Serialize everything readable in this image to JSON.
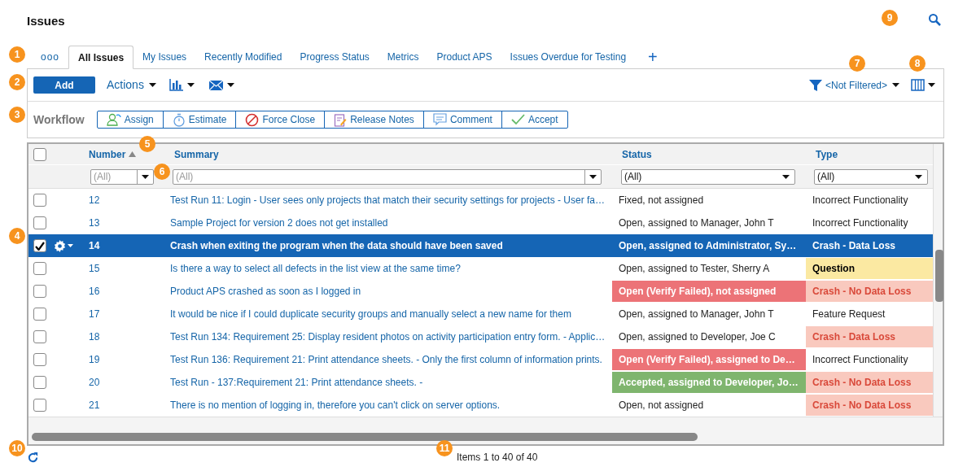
{
  "title": "Issues",
  "tabs": [
    {
      "label": "ooo",
      "selected": false
    },
    {
      "label": "All Issues",
      "selected": true
    },
    {
      "label": "My Issues",
      "selected": false
    },
    {
      "label": "Recently Modified",
      "selected": false
    },
    {
      "label": "Progress Status",
      "selected": false
    },
    {
      "label": "Metrics",
      "selected": false
    },
    {
      "label": "Product APS",
      "selected": false
    },
    {
      "label": "Issues Overdue for Testing",
      "selected": false
    }
  ],
  "add_tab": "+",
  "toolbar": {
    "add": "Add",
    "actions": "Actions",
    "filter": "<Not Filtered>"
  },
  "workflow": {
    "label": "Workflow",
    "buttons": [
      {
        "label": "Assign",
        "kind": "assign"
      },
      {
        "label": "Estimate",
        "kind": "estimate"
      },
      {
        "label": "Force Close",
        "kind": "close"
      },
      {
        "label": "Release Notes",
        "kind": "notes"
      },
      {
        "label": "Comment",
        "kind": "comment"
      },
      {
        "label": "Accept",
        "kind": "accept"
      }
    ]
  },
  "table": {
    "columns": [
      {
        "label": "Number",
        "sorted": true
      },
      {
        "label": "Summary",
        "sorted": false
      },
      {
        "label": "Status",
        "sorted": false
      },
      {
        "label": "Type",
        "sorted": false
      }
    ],
    "select_all": {
      "checked": false
    },
    "filters": [
      "(All)",
      "(All)",
      "(All)",
      "(All)"
    ],
    "rows": [
      {
        "number": "12",
        "summary": "Test Run 11: Login - User sees only projects that match their security settings for projects - User fa…",
        "status": {
          "text": "Fixed, not assigned",
          "kind": "plain"
        },
        "type": {
          "text": "Incorrect Functionality",
          "kind": "plain"
        },
        "selected": false,
        "checked": false
      },
      {
        "number": "13",
        "summary": "Sample Project for version 2 does not get installed",
        "status": {
          "text": "Open, assigned to Manager, John T",
          "kind": "plain"
        },
        "type": {
          "text": "Incorrect Functionality",
          "kind": "plain"
        },
        "selected": false,
        "checked": false
      },
      {
        "number": "14",
        "summary": "Crash when exiting the program when the data should have been saved",
        "status": {
          "text": "Open, assigned to Administrator, Sy…",
          "kind": "plain"
        },
        "type": {
          "text": "Crash - Data Loss",
          "kind": "crash"
        },
        "selected": true,
        "checked": true
      },
      {
        "number": "15",
        "summary": "Is there a way to select all defects in the list view at the same time?",
        "status": {
          "text": "Open, assigned to Tester, Sherry A",
          "kind": "plain"
        },
        "type": {
          "text": "Question",
          "kind": "question"
        },
        "selected": false,
        "checked": false
      },
      {
        "number": "16",
        "summary": "Product APS crashed as soon as I logged in",
        "status": {
          "text": "Open (Verify Failed), not assigned",
          "kind": "failed"
        },
        "type": {
          "text": "Crash - No Data Loss",
          "kind": "crash"
        },
        "selected": false,
        "checked": false
      },
      {
        "number": "17",
        "summary": "It would be nice if I could duplicate security groups and manually select a new name for them",
        "status": {
          "text": "Open, assigned to Manager, John T",
          "kind": "plain"
        },
        "type": {
          "text": "Feature Request",
          "kind": "plain"
        },
        "selected": false,
        "checked": false
      },
      {
        "number": "18",
        "summary": "Test Run 134: Requirement 25: Display resident photos on activity participation entry form. - Applic…",
        "status": {
          "text": "Open, assigned to Developer, Joe C",
          "kind": "plain"
        },
        "type": {
          "text": "Crash - Data Loss",
          "kind": "crash"
        },
        "selected": false,
        "checked": false
      },
      {
        "number": "19",
        "summary": "Test Run 136: Requirement 21: Print attendance sheets. - Only the first column of information prints.",
        "status": {
          "text": "Open (Verify Failed), assigned to De…",
          "kind": "failed"
        },
        "type": {
          "text": "Incorrect Functionality",
          "kind": "plain"
        },
        "selected": false,
        "checked": false
      },
      {
        "number": "20",
        "summary": "Test Run - 137:Requirement 21: Print attendance sheets. -",
        "status": {
          "text": "Accepted, assigned to Developer, Jo…",
          "kind": "accepted"
        },
        "type": {
          "text": "Crash - No Data Loss",
          "kind": "crash"
        },
        "selected": false,
        "checked": false
      },
      {
        "number": "21",
        "summary": "There is no mention of logging in, therefore you can't click on server options.",
        "status": {
          "text": "Open, not assigned",
          "kind": "plain"
        },
        "type": {
          "text": "Crash - No Data Loss",
          "kind": "crash"
        },
        "selected": false,
        "checked": false
      }
    ]
  },
  "footer": "Items 1 to 40 of 40",
  "callouts": [
    "1",
    "2",
    "3",
    "4",
    "5",
    "6",
    "7",
    "8",
    "9",
    "10",
    "11"
  ]
}
